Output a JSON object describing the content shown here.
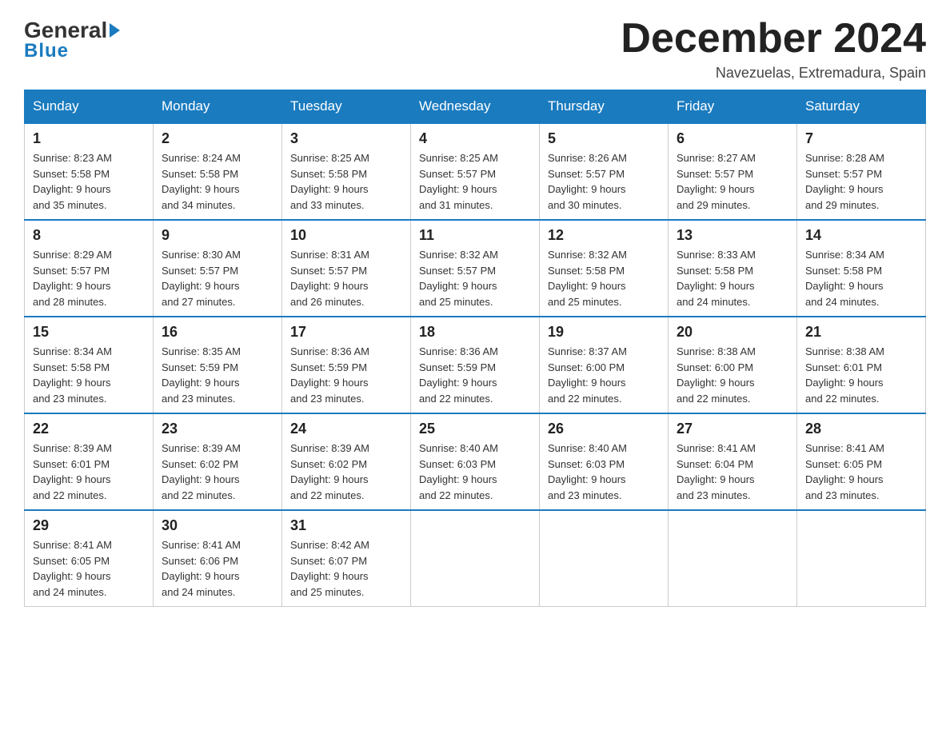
{
  "header": {
    "month_title": "December 2024",
    "subtitle": "Navezuelas, Extremadura, Spain",
    "logo_general": "General",
    "logo_blue": "Blue"
  },
  "days_of_week": [
    "Sunday",
    "Monday",
    "Tuesday",
    "Wednesday",
    "Thursday",
    "Friday",
    "Saturday"
  ],
  "weeks": [
    [
      {
        "day": "1",
        "sunrise": "8:23 AM",
        "sunset": "5:58 PM",
        "daylight": "9 hours and 35 minutes."
      },
      {
        "day": "2",
        "sunrise": "8:24 AM",
        "sunset": "5:58 PM",
        "daylight": "9 hours and 34 minutes."
      },
      {
        "day": "3",
        "sunrise": "8:25 AM",
        "sunset": "5:58 PM",
        "daylight": "9 hours and 33 minutes."
      },
      {
        "day": "4",
        "sunrise": "8:25 AM",
        "sunset": "5:57 PM",
        "daylight": "9 hours and 31 minutes."
      },
      {
        "day": "5",
        "sunrise": "8:26 AM",
        "sunset": "5:57 PM",
        "daylight": "9 hours and 30 minutes."
      },
      {
        "day": "6",
        "sunrise": "8:27 AM",
        "sunset": "5:57 PM",
        "daylight": "9 hours and 29 minutes."
      },
      {
        "day": "7",
        "sunrise": "8:28 AM",
        "sunset": "5:57 PM",
        "daylight": "9 hours and 29 minutes."
      }
    ],
    [
      {
        "day": "8",
        "sunrise": "8:29 AM",
        "sunset": "5:57 PM",
        "daylight": "9 hours and 28 minutes."
      },
      {
        "day": "9",
        "sunrise": "8:30 AM",
        "sunset": "5:57 PM",
        "daylight": "9 hours and 27 minutes."
      },
      {
        "day": "10",
        "sunrise": "8:31 AM",
        "sunset": "5:57 PM",
        "daylight": "9 hours and 26 minutes."
      },
      {
        "day": "11",
        "sunrise": "8:32 AM",
        "sunset": "5:57 PM",
        "daylight": "9 hours and 25 minutes."
      },
      {
        "day": "12",
        "sunrise": "8:32 AM",
        "sunset": "5:58 PM",
        "daylight": "9 hours and 25 minutes."
      },
      {
        "day": "13",
        "sunrise": "8:33 AM",
        "sunset": "5:58 PM",
        "daylight": "9 hours and 24 minutes."
      },
      {
        "day": "14",
        "sunrise": "8:34 AM",
        "sunset": "5:58 PM",
        "daylight": "9 hours and 24 minutes."
      }
    ],
    [
      {
        "day": "15",
        "sunrise": "8:34 AM",
        "sunset": "5:58 PM",
        "daylight": "9 hours and 23 minutes."
      },
      {
        "day": "16",
        "sunrise": "8:35 AM",
        "sunset": "5:59 PM",
        "daylight": "9 hours and 23 minutes."
      },
      {
        "day": "17",
        "sunrise": "8:36 AM",
        "sunset": "5:59 PM",
        "daylight": "9 hours and 23 minutes."
      },
      {
        "day": "18",
        "sunrise": "8:36 AM",
        "sunset": "5:59 PM",
        "daylight": "9 hours and 22 minutes."
      },
      {
        "day": "19",
        "sunrise": "8:37 AM",
        "sunset": "6:00 PM",
        "daylight": "9 hours and 22 minutes."
      },
      {
        "day": "20",
        "sunrise": "8:38 AM",
        "sunset": "6:00 PM",
        "daylight": "9 hours and 22 minutes."
      },
      {
        "day": "21",
        "sunrise": "8:38 AM",
        "sunset": "6:01 PM",
        "daylight": "9 hours and 22 minutes."
      }
    ],
    [
      {
        "day": "22",
        "sunrise": "8:39 AM",
        "sunset": "6:01 PM",
        "daylight": "9 hours and 22 minutes."
      },
      {
        "day": "23",
        "sunrise": "8:39 AM",
        "sunset": "6:02 PM",
        "daylight": "9 hours and 22 minutes."
      },
      {
        "day": "24",
        "sunrise": "8:39 AM",
        "sunset": "6:02 PM",
        "daylight": "9 hours and 22 minutes."
      },
      {
        "day": "25",
        "sunrise": "8:40 AM",
        "sunset": "6:03 PM",
        "daylight": "9 hours and 22 minutes."
      },
      {
        "day": "26",
        "sunrise": "8:40 AM",
        "sunset": "6:03 PM",
        "daylight": "9 hours and 23 minutes."
      },
      {
        "day": "27",
        "sunrise": "8:41 AM",
        "sunset": "6:04 PM",
        "daylight": "9 hours and 23 minutes."
      },
      {
        "day": "28",
        "sunrise": "8:41 AM",
        "sunset": "6:05 PM",
        "daylight": "9 hours and 23 minutes."
      }
    ],
    [
      {
        "day": "29",
        "sunrise": "8:41 AM",
        "sunset": "6:05 PM",
        "daylight": "9 hours and 24 minutes."
      },
      {
        "day": "30",
        "sunrise": "8:41 AM",
        "sunset": "6:06 PM",
        "daylight": "9 hours and 24 minutes."
      },
      {
        "day": "31",
        "sunrise": "8:42 AM",
        "sunset": "6:07 PM",
        "daylight": "9 hours and 25 minutes."
      },
      null,
      null,
      null,
      null
    ]
  ],
  "labels": {
    "sunrise": "Sunrise:",
    "sunset": "Sunset:",
    "daylight": "Daylight:"
  }
}
